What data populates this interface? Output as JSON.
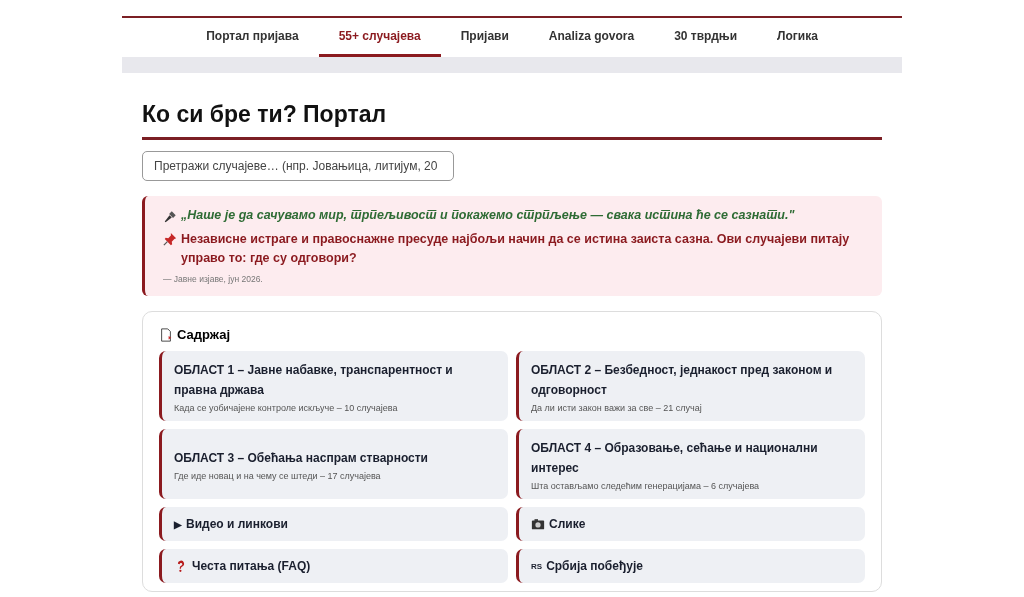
{
  "nav": [
    {
      "label": "Портал пријава",
      "selected": false
    },
    {
      "label": "55+ случајева",
      "selected": true
    },
    {
      "label": "Пријави",
      "selected": false
    },
    {
      "label": "Analiza govora",
      "selected": false
    },
    {
      "label": "30 тврдњи",
      "selected": false
    },
    {
      "label": "Логика",
      "selected": false
    }
  ],
  "title": "Ко си бре ти? Портал",
  "search": {
    "placeholder": "Претражи случајеве… (нпр. Јовањица, литијум, 20"
  },
  "notice": {
    "quote": "„Наше је да сачувамо мир, трпељивост и покажемо стрпљење — свака истина ће се сазнати.\"",
    "message": "Независне истраге и правоснажне пресуде најбољи начин да се истина заиста сазна. Ови случајеви питају управо то: где су одговори?",
    "source": "— Јавне изјаве, јун 2026."
  },
  "contents": {
    "title": "Садржај",
    "items": [
      {
        "kind": "area",
        "title": "ОБЛАСТ 1 – Јавне набавке, транспарентност и правна држава",
        "subtitle": "Када се уобичајене контроле искључе – 10 случајева"
      },
      {
        "kind": "area",
        "title": "ОБЛАСТ 2 – Безбедност, једнакост пред законом и одговорност",
        "subtitle": "Да ли исти закон важи за све – 21 случај"
      },
      {
        "kind": "area",
        "title": "ОБЛАСТ 3 – Обећања наспрам стварности",
        "subtitle": "Где иде новац и на чему се штеди – 17 случајева"
      },
      {
        "kind": "area",
        "title": "ОБЛАСТ 4 – Образовање, сећање и национални интерес",
        "subtitle": "Шта остављамо следећим генерацијама – 6 случајева"
      },
      {
        "kind": "play",
        "glyph": "▶",
        "title": "Видео и линкови"
      },
      {
        "kind": "camera",
        "title": "Слике"
      },
      {
        "kind": "question",
        "title": "Честа питања (FAQ)"
      },
      {
        "kind": "flag",
        "glyph": "RS",
        "title": "Србија побеђује"
      }
    ]
  }
}
